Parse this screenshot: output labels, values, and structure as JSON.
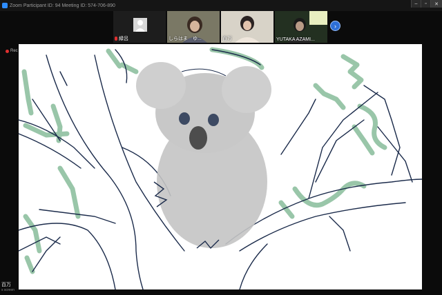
{
  "window": {
    "title": "Zoom Participant ID: 94   Meeting ID: 574-706-890",
    "controls": [
      "–",
      "▫",
      "✕"
    ]
  },
  "participants": [
    {
      "name": "緑呂",
      "muted": true
    },
    {
      "name": "しらはま　ゆ..."
    },
    {
      "name": "百万"
    },
    {
      "name": "YUTAKA AZAMI..."
    }
  ],
  "next_page": "›",
  "recording": {
    "label": "Rec"
  },
  "share": {
    "sharer": "百万",
    "subtitle": "s screen"
  },
  "colors": {
    "thumb_active": "#c9e020",
    "ink": "#1a2a4a",
    "leaf_green": "#8fc0a0",
    "koala_grey": "#bdbdbd",
    "nose": "#4d4d4d",
    "background": "#0b0b0b"
  }
}
